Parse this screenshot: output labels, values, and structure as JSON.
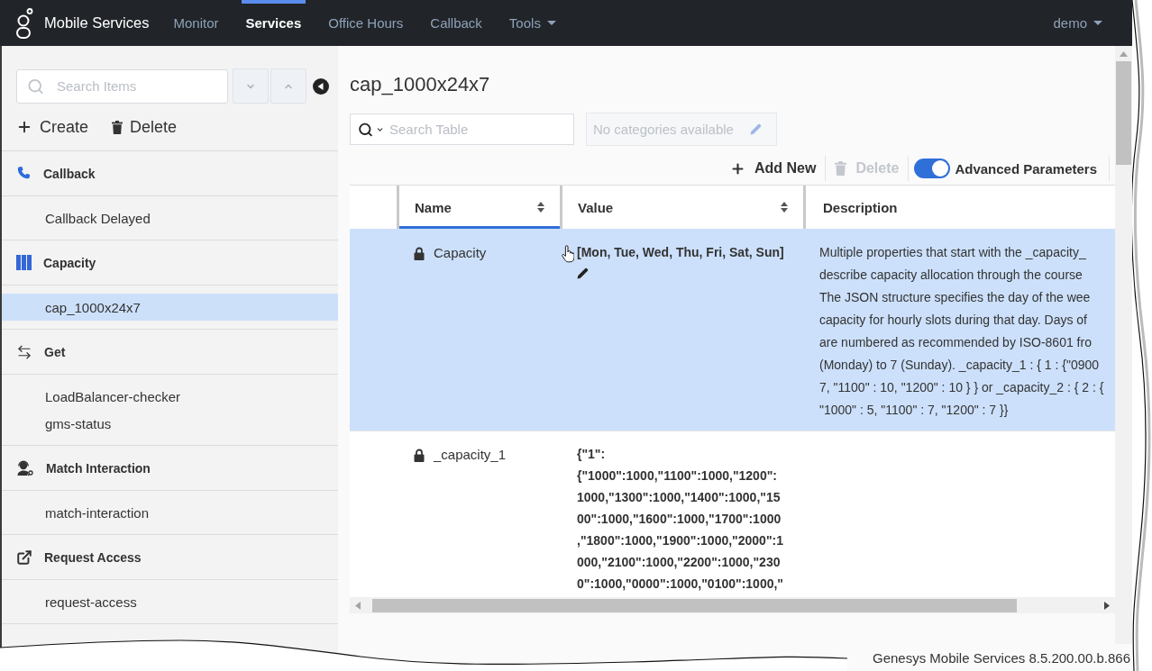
{
  "app": {
    "title": "Mobile Services"
  },
  "nav": {
    "items": [
      {
        "label": "Monitor",
        "selected": false,
        "kind": "link"
      },
      {
        "label": "Services",
        "selected": true,
        "kind": "link"
      },
      {
        "label": "Office Hours",
        "selected": false,
        "kind": "link"
      },
      {
        "label": "Callback",
        "selected": false,
        "kind": "link"
      },
      {
        "label": "Tools",
        "selected": false,
        "kind": "dropdown"
      }
    ],
    "user": "demo"
  },
  "sidebar": {
    "search": {
      "placeholder": "Search Items"
    },
    "actions": [
      {
        "label": "Create",
        "kind": "create"
      },
      {
        "label": "Delete",
        "kind": "delete"
      }
    ],
    "groups": [
      {
        "label": "Callback",
        "kind": "phone",
        "children": [
          {
            "label": "Callback Delayed",
            "selected": false
          }
        ]
      },
      {
        "label": "Capacity",
        "kind": "columns",
        "children": [
          {
            "label": "cap_1000x24x7",
            "selected": true
          }
        ]
      },
      {
        "label": "Get",
        "kind": "swap",
        "children": [
          {
            "label": "LoadBalancer-checker",
            "selected": false
          },
          {
            "label": "gms-status",
            "selected": false
          }
        ]
      },
      {
        "label": "Match Interaction",
        "kind": "agent",
        "children": [
          {
            "label": "match-interaction",
            "selected": false
          }
        ]
      },
      {
        "label": "Request Access",
        "kind": "external",
        "children": [
          {
            "label": "request-access",
            "selected": false
          }
        ]
      }
    ]
  },
  "page": {
    "title": "cap_1000x24x7",
    "search": {
      "placeholder": "Search Table"
    },
    "categories": {
      "text": "No categories available",
      "disabled": true
    },
    "toolbar": [
      {
        "kind": "add",
        "label": "Add New",
        "disabled": false
      },
      {
        "kind": "delete",
        "label": "Delete",
        "disabled": true
      },
      {
        "kind": "toggle",
        "label": "Advanced Parameters",
        "on": true
      }
    ]
  },
  "table": {
    "columns": [
      {
        "label": "Name",
        "sortable": true,
        "sorted": true
      },
      {
        "label": "Value",
        "sortable": true,
        "sorted": false
      },
      {
        "label": "Description",
        "sortable": false,
        "sorted": false
      }
    ],
    "rows": [
      {
        "selected": true,
        "locked": true,
        "name": "Capacity",
        "value_lines": [
          "[Mon, Tue, Wed, Thu, Fri, Sat, Sun]"
        ],
        "description_lines": [
          "Multiple properties that start with the _capacity_",
          "describe capacity allocation through the course",
          "The JSON structure specifies the day of the wee",
          "capacity for hourly slots during that day. Days of",
          "are numbered as recommended by ISO-8601 fro",
          "(Monday) to 7 (Sunday). _capacity_1 : { 1 : {\"0900",
          "7, \"1100\" : 10, \"1200\" : 10 } } or _capacity_2 : { 2 : {",
          "\"1000\" : 5, \"1100\" : 7, \"1200\" : 7 }}"
        ]
      },
      {
        "selected": false,
        "locked": true,
        "name": "_capacity_1",
        "value_lines": [
          "{\"1\":",
          "{\"1000\":1000,\"1100\":1000,\"1200\":",
          "1000,\"1300\":1000,\"1400\":1000,\"15",
          "00\":1000,\"1600\":1000,\"1700\":1000",
          ",\"1800\":1000,\"1900\":1000,\"2000\":1",
          "000,\"2100\":1000,\"2200\":1000,\"230",
          "0\":1000,\"0000\":1000,\"0100\":1000,\""
        ],
        "description_lines": []
      }
    ]
  },
  "footer": {
    "text": "Genesys Mobile Services 8.5.200.00.b.866"
  }
}
